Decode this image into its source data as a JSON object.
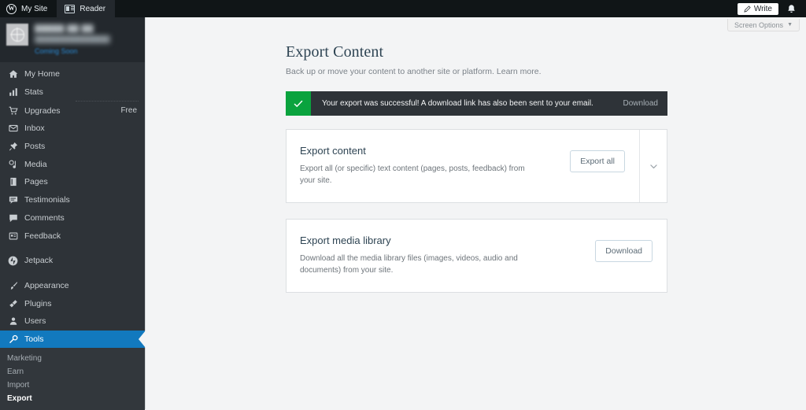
{
  "masterbar": {
    "my_site": "My Site",
    "reader": "Reader",
    "write": "Write",
    "logo_letter": "W"
  },
  "screen_options": {
    "label": "Screen Options",
    "caret": "▼"
  },
  "sidebar": {
    "site": {
      "title": "█████ ██ ██",
      "url": "███████████████",
      "status": "Coming Soon"
    },
    "items": [
      {
        "label": "My Home",
        "icon": "home-icon",
        "badge": ""
      },
      {
        "label": "Stats",
        "icon": "stats-icon",
        "badge": ""
      },
      {
        "label": "Upgrades",
        "icon": "cart-icon",
        "badge": "Free"
      },
      {
        "label": "Inbox",
        "icon": "envelope-icon",
        "badge": ""
      },
      {
        "label": "Posts",
        "icon": "pin-icon",
        "badge": ""
      },
      {
        "label": "Media",
        "icon": "media-icon",
        "badge": ""
      },
      {
        "label": "Pages",
        "icon": "pages-icon",
        "badge": ""
      },
      {
        "label": "Testimonials",
        "icon": "testimonial-icon",
        "badge": ""
      },
      {
        "label": "Comments",
        "icon": "comment-icon",
        "badge": ""
      },
      {
        "label": "Feedback",
        "icon": "feedback-icon",
        "badge": ""
      },
      {
        "label": "Jetpack",
        "icon": "jetpack-icon",
        "badge": ""
      },
      {
        "label": "Appearance",
        "icon": "brush-icon",
        "badge": ""
      },
      {
        "label": "Plugins",
        "icon": "plug-icon",
        "badge": ""
      },
      {
        "label": "Users",
        "icon": "users-icon",
        "badge": ""
      },
      {
        "label": "Tools",
        "icon": "wrench-icon",
        "badge": ""
      }
    ],
    "submenu": [
      {
        "label": "Marketing",
        "current": false
      },
      {
        "label": "Earn",
        "current": false
      },
      {
        "label": "Import",
        "current": false
      },
      {
        "label": "Export",
        "current": true
      }
    ]
  },
  "page": {
    "title": "Export Content",
    "subtitle": "Back up or move your content to another site or platform. Learn more."
  },
  "notice": {
    "message": "Your export was successful! A download link has also been sent to your email.",
    "action": "Download",
    "accent": "#0aa33e"
  },
  "cards": [
    {
      "title": "Export content",
      "description": "Export all (or specific) text content (pages, posts, feedback) from your site.",
      "button": "Export all",
      "has_toggle": true
    },
    {
      "title": "Export media library",
      "description": "Download all the media library files (images, videos, audio and documents) from your site.",
      "button": "Download",
      "has_toggle": false
    }
  ]
}
